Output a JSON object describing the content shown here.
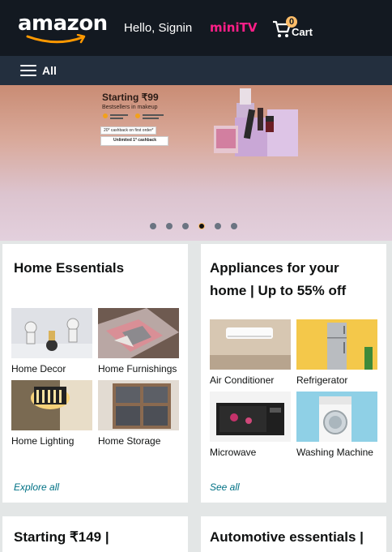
{
  "header": {
    "logo_text": "amazon",
    "greeting": "Hello, Signin",
    "minitv": "miniTV",
    "cart_count": "0",
    "cart_label": "Cart"
  },
  "nav": {
    "all_label": "All"
  },
  "hero": {
    "title": "Starting ₹99",
    "subtitle": "Bestsellers in makeup",
    "tag1": "20* cashback on first order*",
    "tag2": "Unlimited 1* cashback",
    "active_slide": 4,
    "slide_count": 6
  },
  "cards": [
    {
      "title_lines": [
        "Home Essentials"
      ],
      "items": [
        "Home Decor",
        "Home Furnishings",
        "Home Lighting",
        "Home Storage"
      ],
      "link": "Explore all"
    },
    {
      "title_lines": [
        "Appliances for your",
        "home | Up to 55% off"
      ],
      "items": [
        "Air Conditioner",
        "Refrigerator",
        "Microwave",
        "Washing Machine"
      ],
      "link": "See all"
    },
    {
      "title_lines": [
        "Starting ₹149 |"
      ]
    },
    {
      "title_lines": [
        "Automotive essentials |"
      ]
    }
  ],
  "colors": {
    "header_bg": "#131921",
    "nav_bg": "#232f3e",
    "accent": "#febd69",
    "minitv": "#ff1f88",
    "link": "#007185"
  }
}
